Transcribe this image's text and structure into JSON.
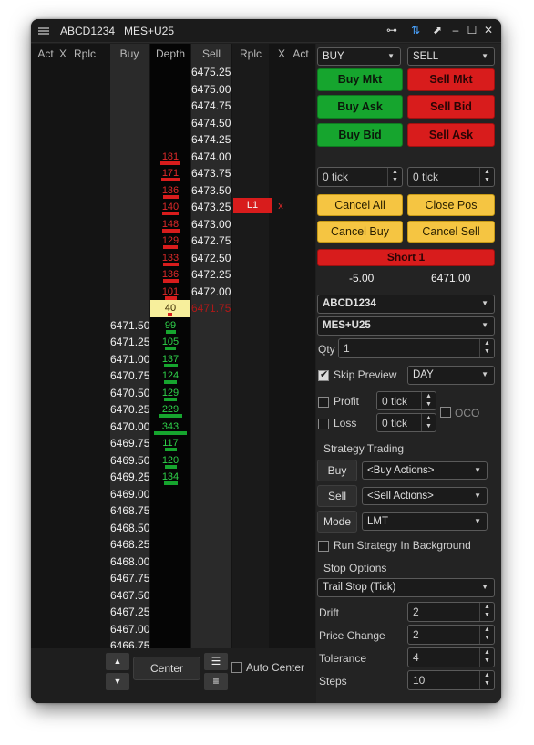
{
  "title": {
    "account": "ABCD1234",
    "instrument": "MES+U25"
  },
  "headers": [
    "Act",
    "X",
    "Rplc",
    "Buy",
    "Depth",
    "Sell",
    "Rplc",
    "X",
    "Act"
  ],
  "prices": [
    "6475.25",
    "6475.00",
    "6474.75",
    "6474.50",
    "6474.25",
    "6474.00",
    "6473.75",
    "6473.50",
    "6473.25",
    "6473.00",
    "6472.75",
    "6472.50",
    "6472.25",
    "6472.00",
    "6471.75",
    "6471.50",
    "6471.25",
    "6471.00",
    "6470.75",
    "6470.50",
    "6470.25",
    "6470.00",
    "6469.75",
    "6469.50",
    "6469.25",
    "6469.00",
    "6468.75",
    "6468.50",
    "6468.25",
    "6468.00",
    "6467.75",
    "6467.50",
    "6467.25",
    "6467.00",
    "6466.75"
  ],
  "sell_depth": [
    {
      "row": 5,
      "value": "181"
    },
    {
      "row": 6,
      "value": "171"
    },
    {
      "row": 7,
      "value": "136"
    },
    {
      "row": 8,
      "value": "140"
    },
    {
      "row": 9,
      "value": "148"
    },
    {
      "row": 10,
      "value": "129"
    },
    {
      "row": 11,
      "value": "133"
    },
    {
      "row": 12,
      "value": "136"
    },
    {
      "row": 13,
      "value": "101"
    }
  ],
  "last_trade": {
    "row": 14,
    "value": "40",
    "price": "6471.75"
  },
  "buy_depth": [
    {
      "row": 15,
      "value": "99"
    },
    {
      "row": 16,
      "value": "105"
    },
    {
      "row": 17,
      "value": "137"
    },
    {
      "row": 18,
      "value": "124"
    },
    {
      "row": 19,
      "value": "129"
    },
    {
      "row": 20,
      "value": "229"
    },
    {
      "row": 21,
      "value": "343"
    },
    {
      "row": 22,
      "value": "117"
    },
    {
      "row": 23,
      "value": "120"
    },
    {
      "row": 24,
      "value": "134"
    }
  ],
  "order_marker": {
    "row": 8,
    "label": "L1",
    "x": "x"
  },
  "bottom": {
    "center_label": "Center",
    "auto_center_label": "Auto Center"
  },
  "panel": {
    "buy_select": "BUY",
    "sell_select": "SELL",
    "buy_mkt": "Buy Mkt",
    "sell_mkt": "Sell Mkt",
    "buy_ask": "Buy Ask",
    "sell_bid": "Sell Bid",
    "buy_bid": "Buy Bid",
    "sell_ask": "Sell Ask",
    "buy_tick": "0 tick",
    "sell_tick": "0 tick",
    "cancel_all": "Cancel All",
    "close_pos": "Close Pos",
    "cancel_buy": "Cancel Buy",
    "cancel_sell": "Cancel Sell",
    "position_label": "Short 1",
    "pnl": "-5.00",
    "avg_price": "6471.00",
    "account_select": "ABCD1234",
    "instrument_select": "MES+U25",
    "qty_label": "Qty",
    "qty_value": "1",
    "skip_preview_label": "Skip Preview",
    "tif_select": "DAY",
    "profit_label": "Profit",
    "profit_value": "0 tick",
    "loss_label": "Loss",
    "loss_value": "0 tick",
    "oco_label": "OCO",
    "strategy_title": "Strategy Trading",
    "buy_label": "Buy",
    "buy_actions": "<Buy Actions>",
    "sell_label": "Sell",
    "sell_actions": "<Sell Actions>",
    "mode_label": "Mode",
    "mode_value": "LMT",
    "run_bg_label": "Run Strategy In Background",
    "stop_options_title": "Stop Options",
    "stop_select": "Trail Stop (Tick)",
    "drift_label": "Drift",
    "drift_value": "2",
    "price_change_label": "Price Change",
    "price_change_value": "2",
    "tolerance_label": "Tolerance",
    "tolerance_value": "4",
    "steps_label": "Steps",
    "steps_value": "10"
  },
  "colors": {
    "buy": "#16a52e",
    "sell": "#d81c1c",
    "cancel": "#f5c542",
    "last": "#f7ef9c",
    "highlight": "#e66bf0"
  }
}
